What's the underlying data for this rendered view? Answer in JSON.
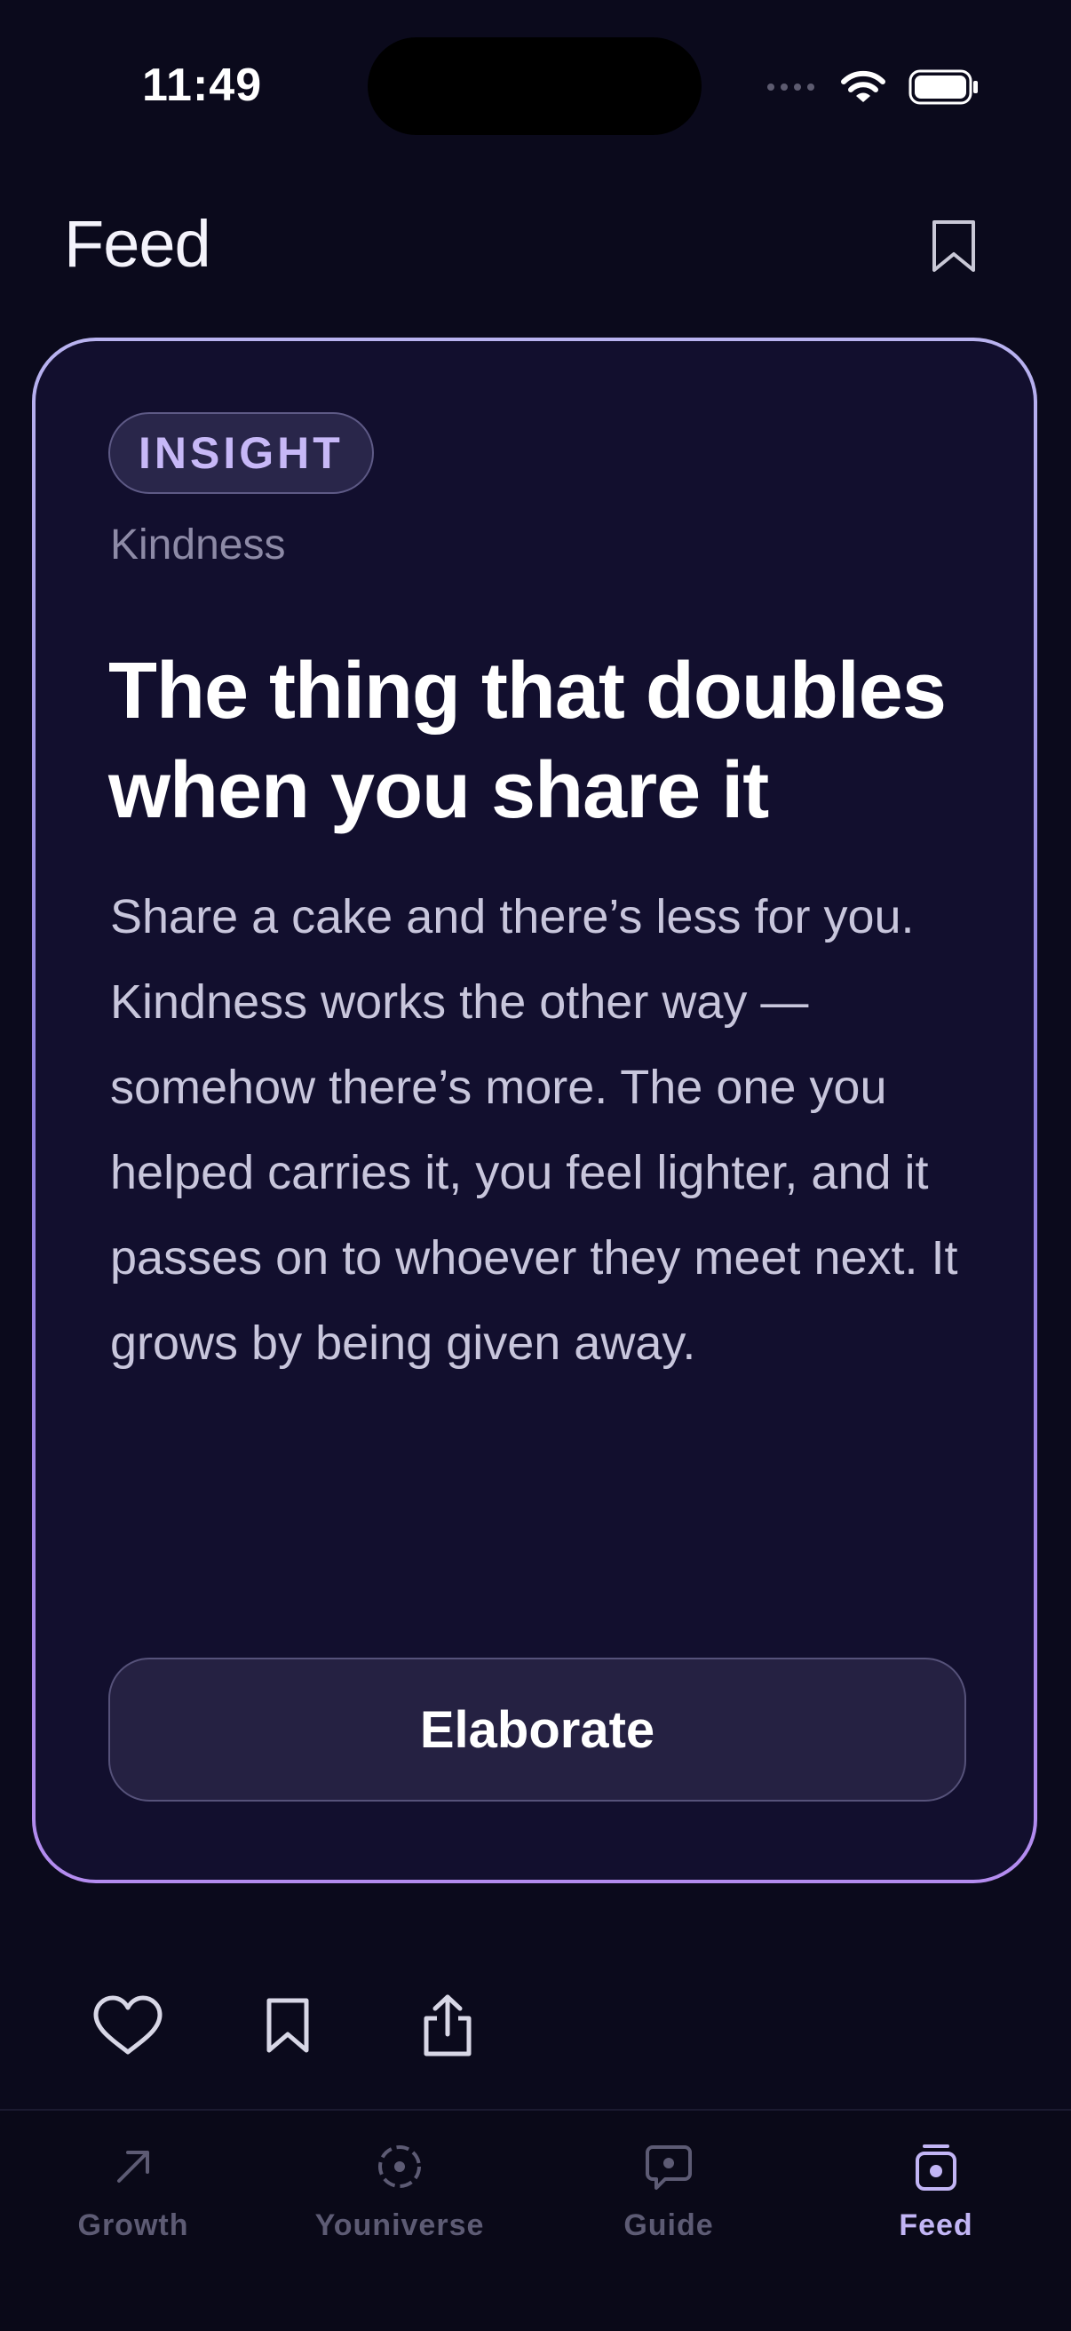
{
  "status_bar": {
    "time": "11:49"
  },
  "header": {
    "title": "Feed",
    "bookmark_icon": "bookmark-icon"
  },
  "card": {
    "badge": "INSIGHT",
    "category": "Kindness",
    "title": "The thing that doubles when you share it",
    "body": "Share a cake and there’s less for you. Kindness works the other way — somehow there’s more. The one you helped carries it, you feel lighter, and it passes on to whoever they meet next. It grows by being given away.",
    "button_label": "Elaborate",
    "accent_color": "#b9b3f0"
  },
  "actions": [
    {
      "name": "like",
      "icon": "heart-icon"
    },
    {
      "name": "save",
      "icon": "bookmark-icon"
    },
    {
      "name": "share",
      "icon": "share-icon"
    }
  ],
  "tabbar": {
    "tabs": [
      {
        "label": "Growth",
        "icon": "arrow-up-right-icon",
        "active": false
      },
      {
        "label": "Youniverse",
        "icon": "orbit-icon",
        "active": false
      },
      {
        "label": "Guide",
        "icon": "chat-bubble-icon",
        "active": false
      },
      {
        "label": "Feed",
        "icon": "feed-card-icon",
        "active": true
      }
    ],
    "active_color": "#c2b5f5",
    "inactive_color": "#5d5b74"
  }
}
